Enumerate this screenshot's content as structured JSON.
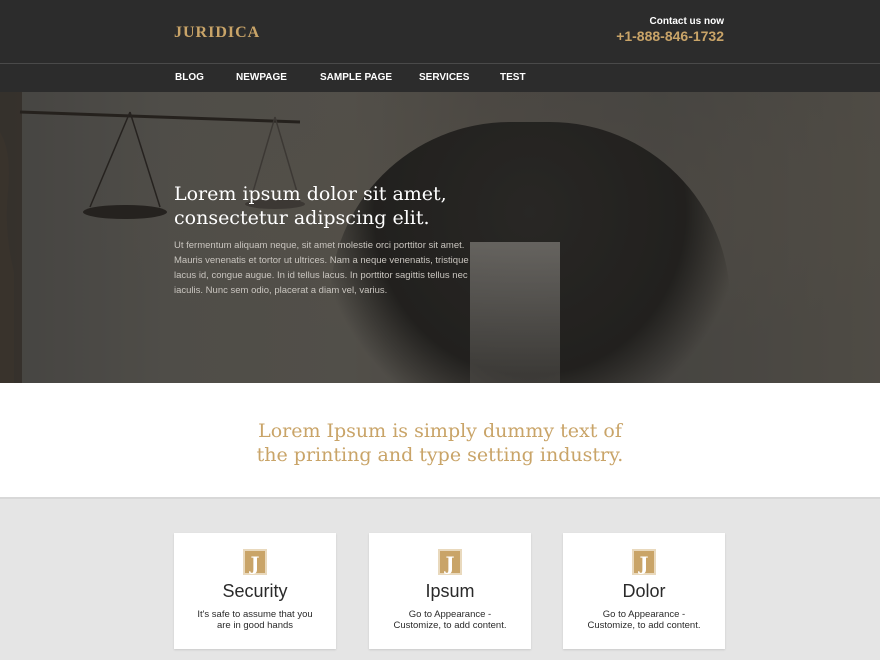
{
  "header": {
    "logo": "JURIDICA",
    "contact_label": "Contact us now",
    "phone": "+1-888-846-1732"
  },
  "nav": {
    "items": [
      {
        "label": "BLOG"
      },
      {
        "label": "NEWPAGE"
      },
      {
        "label": "SAMPLE PAGE"
      },
      {
        "label": "SERVICES"
      },
      {
        "label": "TEST"
      }
    ]
  },
  "hero": {
    "title": "Lorem ipsum dolor sit amet, consectetur adipscing elit.",
    "text": "Ut fermentum aliquam neque, sit amet molestie orci porttitor sit amet. Mauris venenatis et tortor ut ultrices. Nam a neque venenatis, tristique lacus id, congue augue. In id tellus lacus. In porttitor sagittis tellus nec iaculis. Nunc sem odio, placerat a diam vel, varius."
  },
  "tagline": {
    "line1": "Lorem Ipsum is simply dummy text of",
    "line2": "the printing and type setting industry."
  },
  "cards": [
    {
      "icon_letter": "J",
      "title": "Security",
      "text": "It's safe to assume that you are in good hands"
    },
    {
      "icon_letter": "J",
      "title": "Ipsum",
      "text": "Go to Appearance - Customize, to add content."
    },
    {
      "icon_letter": "J",
      "title": "Dolor",
      "text": "Go to Appearance - Customize, to add content."
    }
  ],
  "colors": {
    "accent": "#c9a468",
    "header_bg": "#2c2c2c",
    "section_bg": "#e5e5e5"
  }
}
